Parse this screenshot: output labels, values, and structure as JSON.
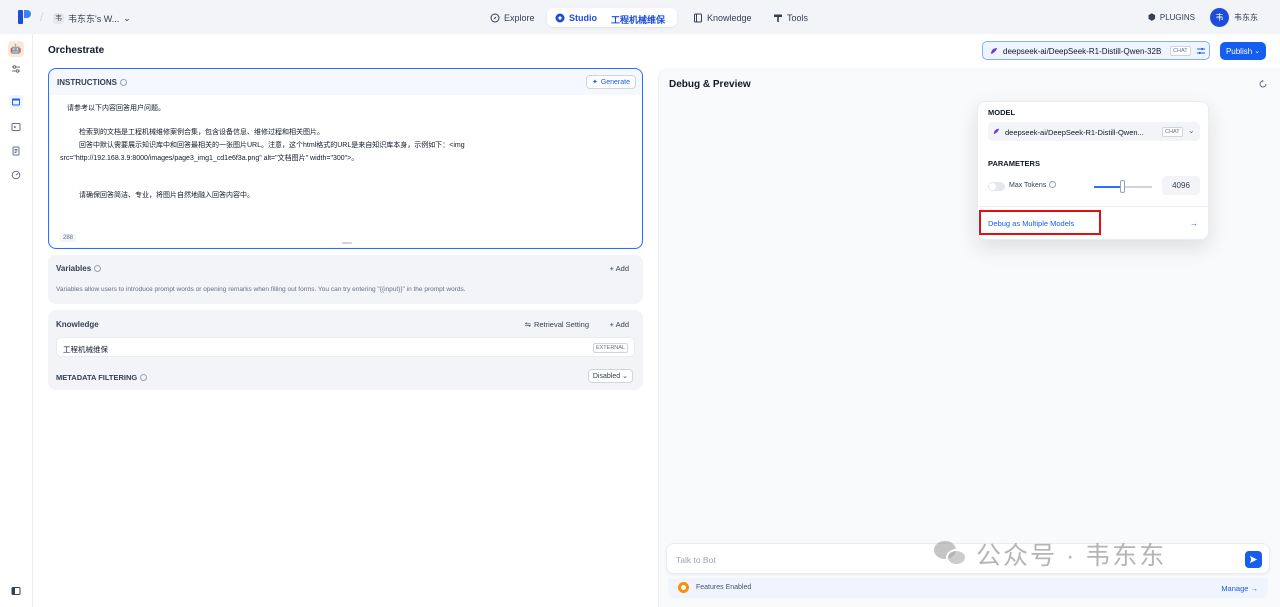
{
  "topbar": {
    "workspace_avatar": "韦",
    "workspace_name": "韦东东's W...",
    "nav": {
      "explore": "Explore",
      "studio": "Studio",
      "app_name": "工程机械维保",
      "knowledge": "Knowledge",
      "tools": "Tools"
    },
    "plugins": "PLUGINS",
    "user_avatar": "韦",
    "user_name": "韦东东"
  },
  "page": {
    "title": "Orchestrate"
  },
  "model_selector": {
    "name": "deepseek-ai/DeepSeek-R1-Distill-Qwen-32B",
    "mode": "CHAT"
  },
  "publish": {
    "label": "Publish"
  },
  "instructions": {
    "title": "INSTRUCTIONS",
    "generate": "Generate",
    "lines": [
      "请参考以下内容回答用户问题。",
      "检索到的文档是工程机械维修案例合集，包含设备信息、维修过程和相关图片。",
      "回答中默认需要展示知识库中和回答最相关的一张图片URL。注意，这个html格式的URL是来自知识库本身，示例如下：<img",
      "src=\"http://192.168.3.9:8000/images/page3_img1_cd1e6f3a.png\" alt=\"文档图片\" width=\"300\">。",
      "请确保回答简洁、专业，将图片自然地融入回答内容中。"
    ],
    "char_count": "288"
  },
  "variables": {
    "title": "Variables",
    "add": "+ Add",
    "description": "Variables allow users to introduce prompt words or opening remarks when filling out forms. You can try entering \"{{input}}\" in the prompt words."
  },
  "knowledge": {
    "title": "Knowledge",
    "retrieval_setting": "Retrieval Setting",
    "add": "+ Add",
    "items": [
      {
        "name": "工程机械维保",
        "tag": "EXTERNAL"
      }
    ],
    "metadata_filtering": "METADATA FILTERING",
    "metadata_value": "Disabled"
  },
  "debug": {
    "title": "Debug & Preview",
    "input_placeholder": "Talk to Bot",
    "features": "Features Enabled",
    "manage": "Manage →"
  },
  "popup": {
    "model_label": "MODEL",
    "model_name": "deepseek-ai/DeepSeek-R1-Distill-Qwen...",
    "model_mode": "CHAT",
    "parameters_label": "PARAMETERS",
    "max_tokens_label": "Max Tokens",
    "max_tokens_value": "4096",
    "max_tokens_slider_fraction": 0.5,
    "debug_multiple": "Debug as Multiple Models",
    "arrow": "→"
  },
  "watermark": {
    "text": "公众号 · 韦东东"
  },
  "colors": {
    "accent": "#155eef",
    "highlight": "#e01010",
    "panel": "#f2f4f7"
  }
}
